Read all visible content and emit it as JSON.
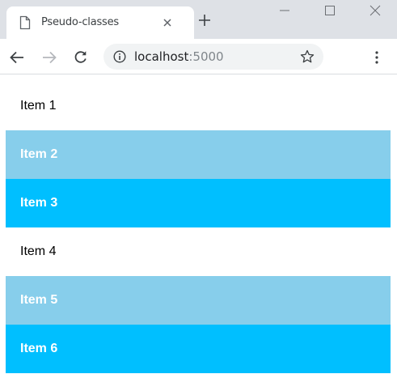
{
  "browser": {
    "tab": {
      "title": "Pseudo-classes"
    },
    "address": {
      "host": "localhost",
      "port": ":5000"
    }
  },
  "page": {
    "items": [
      {
        "label": "Item 1",
        "style": "plain"
      },
      {
        "label": "Item 2",
        "style": "light"
      },
      {
        "label": "Item 3",
        "style": "deep"
      },
      {
        "label": "Item 4",
        "style": "plain"
      },
      {
        "label": "Item 5",
        "style": "light"
      },
      {
        "label": "Item 6",
        "style": "deep"
      }
    ]
  },
  "colors": {
    "light_bg": "#87ceeb",
    "deep_bg": "#00bfff",
    "plain_bg": "#ffffff",
    "tabstrip_bg": "#dee1e6",
    "omnibox_bg": "#f1f3f4"
  },
  "icons": {
    "tab": "page-icon",
    "tab_close": "close-icon",
    "new_tab": "plus-icon",
    "minimize": "minimize-icon",
    "maximize": "maximize-icon",
    "close_window": "close-window-icon",
    "back": "back-arrow-icon",
    "forward": "forward-arrow-icon",
    "reload": "reload-icon",
    "site_info": "info-icon",
    "bookmark": "star-icon",
    "menu": "kebab-menu-icon"
  }
}
